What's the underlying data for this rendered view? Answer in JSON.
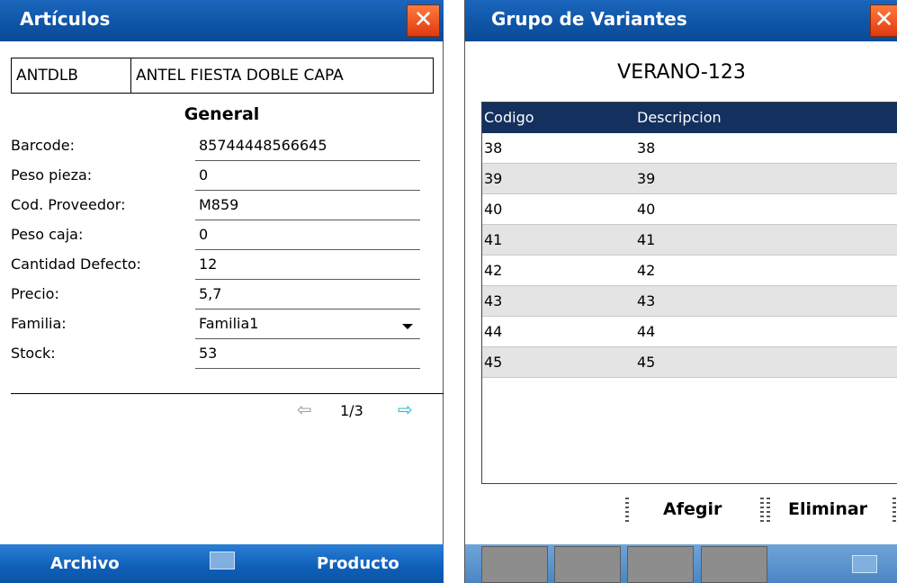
{
  "left": {
    "title": "Artículos",
    "close_symbol": "✕",
    "code": "ANTDLB",
    "description": "ANTEL FIESTA DOBLE CAPA",
    "section": "General",
    "fields": [
      {
        "label": "Barcode:",
        "value": "85744448566645"
      },
      {
        "label": "Peso pieza:",
        "value": "0"
      },
      {
        "label": "Cod. Proveedor:",
        "value": "M859"
      },
      {
        "label": "Peso caja:",
        "value": "0"
      },
      {
        "label": "Cantidad Defecto:",
        "value": "12"
      },
      {
        "label": "Precio:",
        "value": "5,7"
      },
      {
        "label": "Familia:",
        "value": "Familia1"
      },
      {
        "label": "Stock:",
        "value": "53"
      }
    ],
    "pager": {
      "text": "1/3",
      "prev_icon": "⇦",
      "next_icon": "⇨"
    },
    "menu": {
      "left": "Archivo",
      "right": "Producto"
    }
  },
  "right": {
    "title": "Grupo de Variantes",
    "close_symbol": "✕",
    "group_name": "VERANO-123",
    "columns": [
      "Codigo",
      "Descripcion"
    ],
    "rows": [
      [
        "38",
        "38"
      ],
      [
        "39",
        "39"
      ],
      [
        "40",
        "40"
      ],
      [
        "41",
        "41"
      ],
      [
        "42",
        "42"
      ],
      [
        "43",
        "43"
      ],
      [
        "44",
        "44"
      ],
      [
        "45",
        "45"
      ]
    ],
    "buttons": {
      "add": "Afegir",
      "delete": "Eliminar"
    }
  },
  "colors": {
    "title_bar": "#0f55a6",
    "close": "#e03a10",
    "table_header": "#13305e",
    "row_alt": "#e4e4e4"
  }
}
